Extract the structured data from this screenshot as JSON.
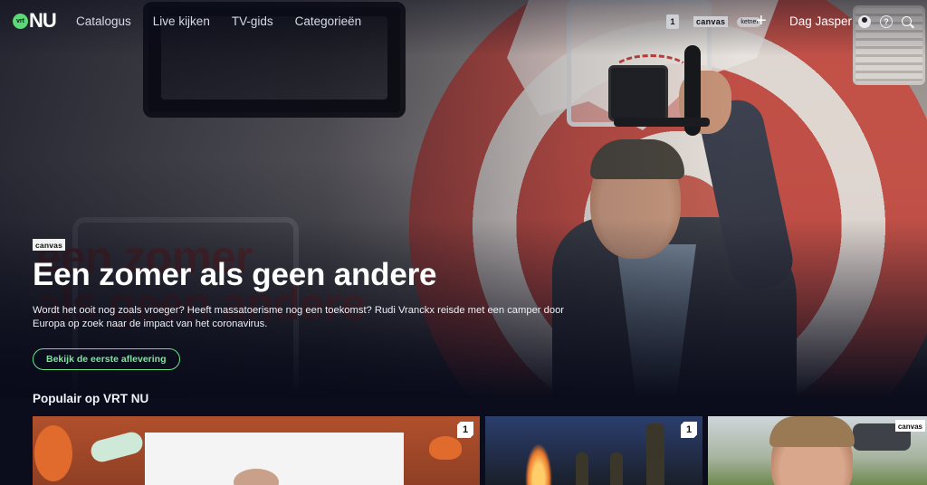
{
  "nav": {
    "logo_badge": "vrt",
    "logo_text": "NU",
    "menu": [
      "Catalogus",
      "Live kijken",
      "TV-gids",
      "Categorieën"
    ],
    "channels": [
      "1",
      "canvas",
      "ketnet"
    ],
    "user_greeting": "Dag Jasper",
    "icons": [
      "plus-icon",
      "profile-icon",
      "help-icon",
      "search-icon"
    ]
  },
  "hero": {
    "brand": "canvas",
    "background_lettering": "een zomer als geen andere",
    "title": "Een zomer als geen andere",
    "description": "Wordt het ooit nog zoals vroeger? Heeft massatoerisme nog een toekomst? Rudi Vranckx reisde met een camper door Europa op zoek naar de impact van het coronavirus.",
    "cta_label": "Bekijk de eerste aflevering"
  },
  "popular": {
    "title": "Populair op VRT NU",
    "tiles": [
      {
        "channel": "1"
      },
      {
        "channel": "1"
      },
      {
        "channel": "canvas"
      }
    ]
  },
  "colors": {
    "accent": "#5cd877",
    "background": "#0b0d1c"
  }
}
